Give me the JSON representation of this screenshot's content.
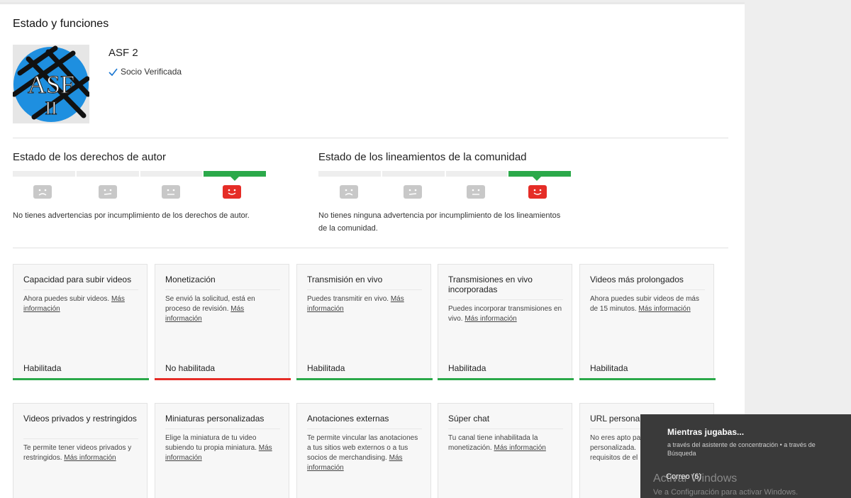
{
  "page": {
    "title": "Estado y funciones"
  },
  "channel": {
    "name": "ASF 2",
    "verified_label": "Socio Verificada",
    "avatar_icon": "asf-ii-logo"
  },
  "copyright": {
    "title": "Estado de los derechos de autor",
    "text": "No tienes advertencias por incumplimiento de los derechos de autor.",
    "faces": [
      "sad-face-icon",
      "neutral-face-icon",
      "neutral-face-icon",
      "happy-face-icon"
    ],
    "active_index": 3
  },
  "community": {
    "title": "Estado de los lineamientos de la comunidad",
    "text_line1": "No tienes ninguna advertencia por incumplimiento de los lineamientos",
    "text_line2": "de la comunidad.",
    "faces": [
      "sad-face-icon",
      "neutral-face-icon",
      "neutral-face-icon",
      "happy-face-icon"
    ],
    "active_index": 3
  },
  "colors": {
    "enabled": "#2ba94a",
    "disabled": "#e52d27",
    "accent": "#1976d2"
  },
  "cards_row1": [
    {
      "title": "Capacidad para subir videos",
      "desc": "Ahora puedes subir videos.",
      "link": "Más información",
      "status": "Habilitada",
      "state": "enabled"
    },
    {
      "title": "Monetización",
      "desc": "Se envió la solicitud, está en proceso de revisión.",
      "link": "Más información",
      "status": "No habilitada",
      "state": "disabled"
    },
    {
      "title": "Transmisión en vivo",
      "desc": "Puedes transmitir en vivo.",
      "link": "Más información",
      "status": "Habilitada",
      "state": "enabled"
    },
    {
      "title": "Transmisiones en vivo incorporadas",
      "desc": "Puedes incorporar transmisiones en vivo.",
      "link": "Más información",
      "status": "Habilitada",
      "state": "enabled"
    },
    {
      "title": "Videos más prolongados",
      "desc": "Ahora puedes subir videos de más de 15 minutos.",
      "link": "Más información",
      "status": "Habilitada",
      "state": "enabled"
    }
  ],
  "cards_row2": [
    {
      "title": "Videos privados y restringidos",
      "desc": "Te permite tener videos privados y restringidos.",
      "link": "Más información"
    },
    {
      "title": "Miniaturas personalizadas",
      "desc": "Elige la miniatura de tu video subiendo tu propia miniatura.",
      "link": "Más información"
    },
    {
      "title": "Anotaciones externas",
      "desc": "Te permite vincular las anotaciones a tus sitios web externos o a tus socios de merchandising.",
      "link": "Más información"
    },
    {
      "title": "Súper chat",
      "desc": "Tu canal tiene inhabilitada la monetización.",
      "link": "Más información"
    },
    {
      "title": "URL persona",
      "desc": "No eres apto pa personalizada. requisitos de el",
      "link": ""
    }
  ],
  "notification": {
    "title": "Mientras jugabas...",
    "subtitle": "a través del asistente de concentración • a través de Búsqueda",
    "mail": "Correo (6)"
  },
  "watermark": {
    "line1": "Activar Windows",
    "line2": "Ve a Configuración para activar Windows."
  }
}
